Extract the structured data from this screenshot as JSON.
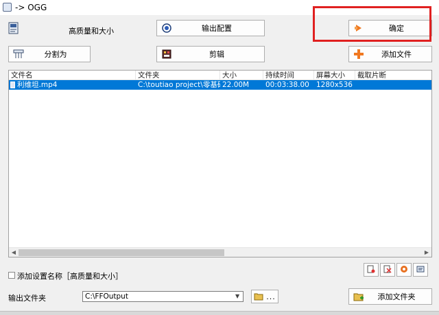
{
  "window": {
    "title": "-> OGG"
  },
  "toolbar": {
    "quality_label": "高质量和大小",
    "output_config_label": "输出配置",
    "ok_label": "确定",
    "split_label": "分割为",
    "clip_label": "剪辑",
    "add_file_label": "添加文件"
  },
  "table": {
    "columns": [
      "文件名",
      "文件夹",
      "大小",
      "持续时间",
      "屏幕大小",
      "截取片断"
    ],
    "rows": [
      {
        "name": "利维坦.mp4",
        "folder": "C:\\toutiao project\\零基础自学...",
        "size": "22.00M",
        "duration": "00:03:38.00",
        "screen": "1280x536",
        "clip": ""
      }
    ]
  },
  "settings": {
    "add_setting_name_label": "添加设置名称［高质量和大小］",
    "output_folder_label": "输出文件夹",
    "output_folder_value": "C:\\FFOutput",
    "browse_label": "...",
    "add_folder_label": "添加文件夹"
  },
  "colors": {
    "selection": "#0078d7",
    "highlight_border": "#e02020",
    "ok_arrow": "#f07820",
    "add_plus": "#f07820"
  }
}
